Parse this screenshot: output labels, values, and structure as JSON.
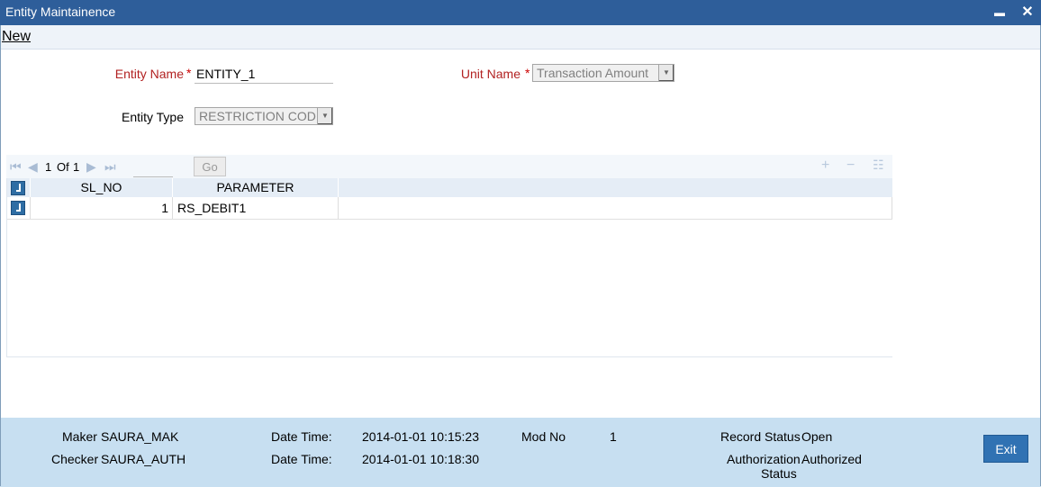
{
  "window": {
    "title": "Entity Maintainence",
    "minimize_glyph": "▬",
    "close_glyph": "✕"
  },
  "menu": {
    "new_label": "New"
  },
  "form": {
    "entity_name_label": "Entity Name",
    "entity_name_value": "ENTITY_1",
    "unit_name_label": "Unit Name",
    "unit_name_value": "Transaction Amount",
    "entity_type_label": "Entity Type",
    "entity_type_value": "RESTRICTION CODE",
    "required_marker": "*"
  },
  "grid": {
    "page_current": "1",
    "page_of": "Of",
    "page_total": "1",
    "go_label": "Go",
    "columns": [
      "SL_NO",
      "PARAMETER"
    ],
    "rows": [
      {
        "sl_no": "1",
        "parameter": "RS_DEBIT1"
      }
    ],
    "icons": [
      "first-page-icon",
      "prev-page-icon",
      "next-page-icon",
      "last-page-icon",
      "add-row-icon",
      "delete-row-icon",
      "single-view-icon"
    ]
  },
  "footer": {
    "maker_label": "Maker",
    "maker_value": "SAURA_MAK",
    "checker_label": "Checker",
    "checker_value": "SAURA_AUTH",
    "datetime_label_1": "Date Time:",
    "datetime_value_1": "2014-01-01 10:15:23",
    "datetime_label_2": "Date Time:",
    "datetime_value_2": "2014-01-01 10:18:30",
    "mod_no_label": "Mod No",
    "mod_no_value": "1",
    "record_status_label": "Record Status",
    "record_status_value": "Open",
    "auth_status_label_1": "Authorization",
    "auth_status_label_2": "Status",
    "auth_status_value": "Authorized",
    "exit_label": "Exit"
  },
  "colors": {
    "titlebar": "#2e5e9a",
    "footer": "#c7dff1",
    "exit_button": "#3072b3",
    "required": "#c00000"
  }
}
